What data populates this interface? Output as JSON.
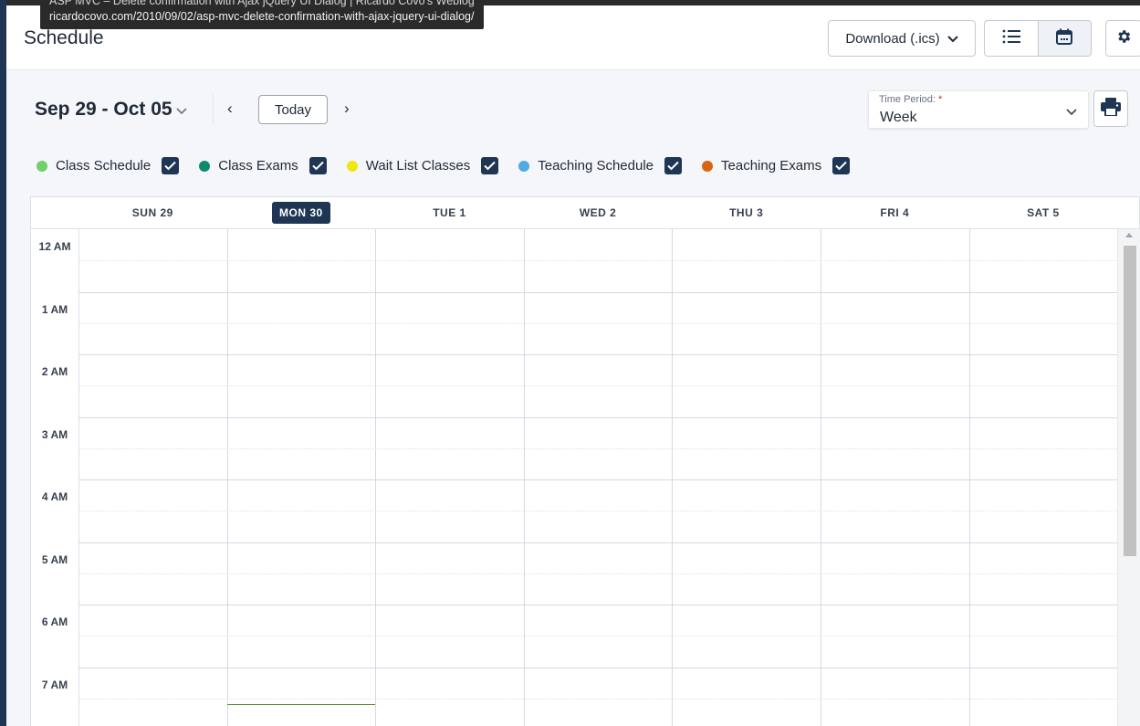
{
  "tooltip": {
    "line1": "ASP MVC – Delete confirmation with Ajax jQuery UI Dialog | Ricardo Covo's Weblog",
    "url": "ricardocovo.com/2010/09/02/asp-mvc-delete-confirmation-with-ajax-jquery-ui-dialog/"
  },
  "header": {
    "title": "Schedule",
    "download_label": "Download (.ics)",
    "list_view_icon": "list-icon",
    "calendar_view_icon": "calendar-icon",
    "settings_icon": "gear-icon"
  },
  "toolbar": {
    "range": "Sep 29 - Oct 05",
    "today": "Today",
    "prev": "‹",
    "next": "›",
    "period_label": "Time Period:",
    "period_required": "*",
    "period_value": "Week",
    "print_icon": "printer-icon"
  },
  "legend": [
    {
      "label": "Class Schedule",
      "color": "#6fd06a",
      "checked": true
    },
    {
      "label": "Class Exams",
      "color": "#0c8a6b",
      "checked": true
    },
    {
      "label": "Wait List Classes",
      "color": "#f2e611",
      "checked": true
    },
    {
      "label": "Teaching Schedule",
      "color": "#4fa9e3",
      "checked": true
    },
    {
      "label": "Teaching Exams",
      "color": "#d9640f",
      "checked": true
    }
  ],
  "days": [
    {
      "label": "SUN 29",
      "today": false
    },
    {
      "label": "MON 30",
      "today": true
    },
    {
      "label": "TUE 1",
      "today": false
    },
    {
      "label": "WED 2",
      "today": false
    },
    {
      "label": "THU 3",
      "today": false
    },
    {
      "label": "FRI 4",
      "today": false
    },
    {
      "label": "SAT 5",
      "today": false
    }
  ],
  "hours": [
    "12 AM",
    "1 AM",
    "2 AM",
    "3 AM",
    "4 AM",
    "5 AM",
    "6 AM",
    "7 AM"
  ],
  "colors": {
    "brand": "#1e3553",
    "today_badge": "#1e3553"
  }
}
